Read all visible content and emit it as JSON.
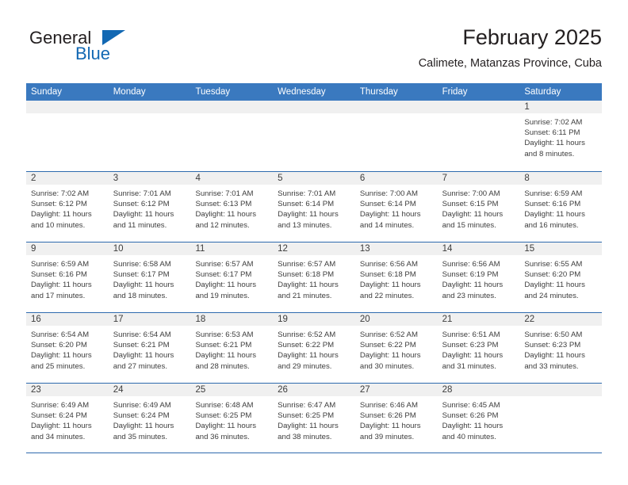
{
  "brand": {
    "name_top": "General",
    "name_bottom": "Blue",
    "accent_color": "#1268b3"
  },
  "header": {
    "title": "February 2025",
    "subtitle": "Calimete, Matanzas Province, Cuba"
  },
  "theme": {
    "header_row_bg": "#3a79bf",
    "header_row_text": "#ffffff",
    "row_divider": "#2e6aae",
    "day_number_band": "#f0f0f0",
    "body_text": "#3d3d3d"
  },
  "weekdays": [
    "Sunday",
    "Monday",
    "Tuesday",
    "Wednesday",
    "Thursday",
    "Friday",
    "Saturday"
  ],
  "labels": {
    "sunrise": "Sunrise:",
    "sunset": "Sunset:",
    "daylight": "Daylight:"
  },
  "weeks": [
    [
      {
        "empty": true
      },
      {
        "empty": true
      },
      {
        "empty": true
      },
      {
        "empty": true
      },
      {
        "empty": true
      },
      {
        "empty": true
      },
      {
        "day": "1",
        "sunrise": "Sunrise: 7:02 AM",
        "sunset": "Sunset: 6:11 PM",
        "daylight": "Daylight: 11 hours and 8 minutes."
      }
    ],
    [
      {
        "day": "2",
        "sunrise": "Sunrise: 7:02 AM",
        "sunset": "Sunset: 6:12 PM",
        "daylight": "Daylight: 11 hours and 10 minutes."
      },
      {
        "day": "3",
        "sunrise": "Sunrise: 7:01 AM",
        "sunset": "Sunset: 6:12 PM",
        "daylight": "Daylight: 11 hours and 11 minutes."
      },
      {
        "day": "4",
        "sunrise": "Sunrise: 7:01 AM",
        "sunset": "Sunset: 6:13 PM",
        "daylight": "Daylight: 11 hours and 12 minutes."
      },
      {
        "day": "5",
        "sunrise": "Sunrise: 7:01 AM",
        "sunset": "Sunset: 6:14 PM",
        "daylight": "Daylight: 11 hours and 13 minutes."
      },
      {
        "day": "6",
        "sunrise": "Sunrise: 7:00 AM",
        "sunset": "Sunset: 6:14 PM",
        "daylight": "Daylight: 11 hours and 14 minutes."
      },
      {
        "day": "7",
        "sunrise": "Sunrise: 7:00 AM",
        "sunset": "Sunset: 6:15 PM",
        "daylight": "Daylight: 11 hours and 15 minutes."
      },
      {
        "day": "8",
        "sunrise": "Sunrise: 6:59 AM",
        "sunset": "Sunset: 6:16 PM",
        "daylight": "Daylight: 11 hours and 16 minutes."
      }
    ],
    [
      {
        "day": "9",
        "sunrise": "Sunrise: 6:59 AM",
        "sunset": "Sunset: 6:16 PM",
        "daylight": "Daylight: 11 hours and 17 minutes."
      },
      {
        "day": "10",
        "sunrise": "Sunrise: 6:58 AM",
        "sunset": "Sunset: 6:17 PM",
        "daylight": "Daylight: 11 hours and 18 minutes."
      },
      {
        "day": "11",
        "sunrise": "Sunrise: 6:57 AM",
        "sunset": "Sunset: 6:17 PM",
        "daylight": "Daylight: 11 hours and 19 minutes."
      },
      {
        "day": "12",
        "sunrise": "Sunrise: 6:57 AM",
        "sunset": "Sunset: 6:18 PM",
        "daylight": "Daylight: 11 hours and 21 minutes."
      },
      {
        "day": "13",
        "sunrise": "Sunrise: 6:56 AM",
        "sunset": "Sunset: 6:18 PM",
        "daylight": "Daylight: 11 hours and 22 minutes."
      },
      {
        "day": "14",
        "sunrise": "Sunrise: 6:56 AM",
        "sunset": "Sunset: 6:19 PM",
        "daylight": "Daylight: 11 hours and 23 minutes."
      },
      {
        "day": "15",
        "sunrise": "Sunrise: 6:55 AM",
        "sunset": "Sunset: 6:20 PM",
        "daylight": "Daylight: 11 hours and 24 minutes."
      }
    ],
    [
      {
        "day": "16",
        "sunrise": "Sunrise: 6:54 AM",
        "sunset": "Sunset: 6:20 PM",
        "daylight": "Daylight: 11 hours and 25 minutes."
      },
      {
        "day": "17",
        "sunrise": "Sunrise: 6:54 AM",
        "sunset": "Sunset: 6:21 PM",
        "daylight": "Daylight: 11 hours and 27 minutes."
      },
      {
        "day": "18",
        "sunrise": "Sunrise: 6:53 AM",
        "sunset": "Sunset: 6:21 PM",
        "daylight": "Daylight: 11 hours and 28 minutes."
      },
      {
        "day": "19",
        "sunrise": "Sunrise: 6:52 AM",
        "sunset": "Sunset: 6:22 PM",
        "daylight": "Daylight: 11 hours and 29 minutes."
      },
      {
        "day": "20",
        "sunrise": "Sunrise: 6:52 AM",
        "sunset": "Sunset: 6:22 PM",
        "daylight": "Daylight: 11 hours and 30 minutes."
      },
      {
        "day": "21",
        "sunrise": "Sunrise: 6:51 AM",
        "sunset": "Sunset: 6:23 PM",
        "daylight": "Daylight: 11 hours and 31 minutes."
      },
      {
        "day": "22",
        "sunrise": "Sunrise: 6:50 AM",
        "sunset": "Sunset: 6:23 PM",
        "daylight": "Daylight: 11 hours and 33 minutes."
      }
    ],
    [
      {
        "day": "23",
        "sunrise": "Sunrise: 6:49 AM",
        "sunset": "Sunset: 6:24 PM",
        "daylight": "Daylight: 11 hours and 34 minutes."
      },
      {
        "day": "24",
        "sunrise": "Sunrise: 6:49 AM",
        "sunset": "Sunset: 6:24 PM",
        "daylight": "Daylight: 11 hours and 35 minutes."
      },
      {
        "day": "25",
        "sunrise": "Sunrise: 6:48 AM",
        "sunset": "Sunset: 6:25 PM",
        "daylight": "Daylight: 11 hours and 36 minutes."
      },
      {
        "day": "26",
        "sunrise": "Sunrise: 6:47 AM",
        "sunset": "Sunset: 6:25 PM",
        "daylight": "Daylight: 11 hours and 38 minutes."
      },
      {
        "day": "27",
        "sunrise": "Sunrise: 6:46 AM",
        "sunset": "Sunset: 6:26 PM",
        "daylight": "Daylight: 11 hours and 39 minutes."
      },
      {
        "day": "28",
        "sunrise": "Sunrise: 6:45 AM",
        "sunset": "Sunset: 6:26 PM",
        "daylight": "Daylight: 11 hours and 40 minutes."
      },
      {
        "empty": true
      }
    ]
  ]
}
